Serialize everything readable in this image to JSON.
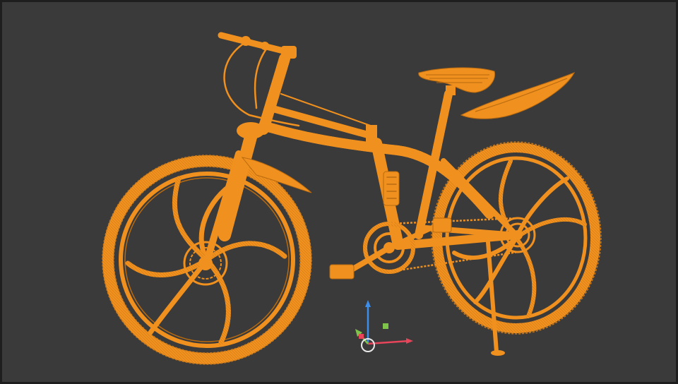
{
  "viewport": {
    "background": "#3a3a3a",
    "border_color": "#1e1e1e"
  },
  "model": {
    "subject": "bicycle-wireframe",
    "wire_color": "#f0901e",
    "wire_dark": "#b86a10"
  },
  "gizmo": {
    "x_axis_color": "#e8445a",
    "y_axis_color": "#7fc44a",
    "z_axis_color": "#3d8eea",
    "origin_color": "#e8e8e8"
  }
}
